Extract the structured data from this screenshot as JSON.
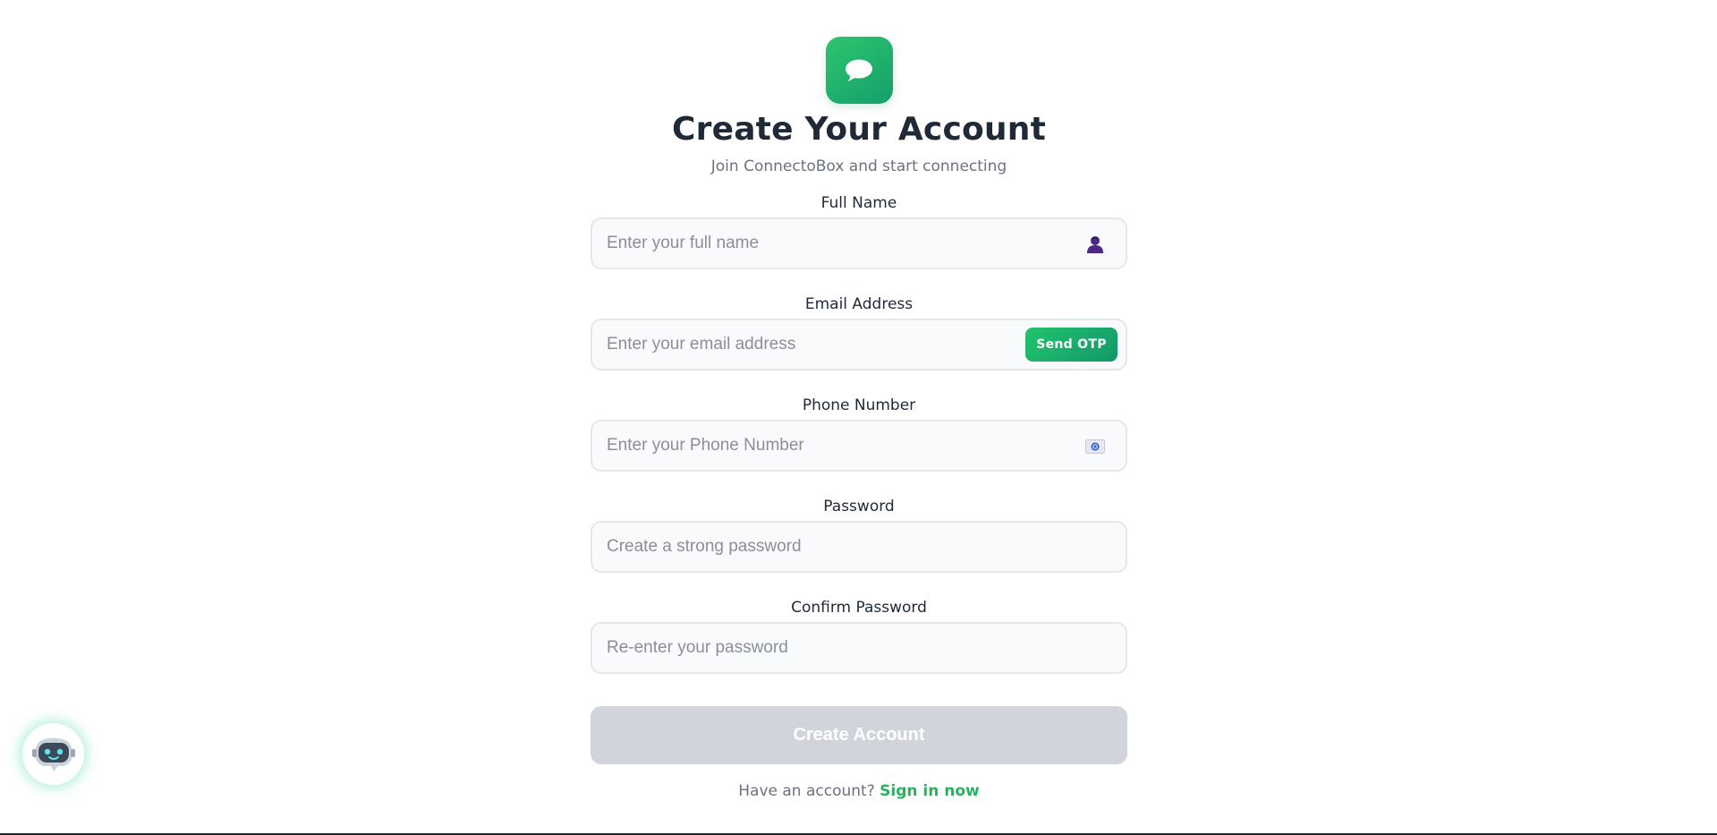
{
  "brand": {
    "logo_icon": "chat-bubble-icon",
    "accent_color": "#22c36d"
  },
  "header": {
    "title": "Create Your Account",
    "subtitle": "Join ConnectoBox and start connecting"
  },
  "form": {
    "full_name": {
      "label": "Full Name",
      "value": "",
      "placeholder": "Enter your full name",
      "icon": "person-icon"
    },
    "email": {
      "label": "Email Address",
      "value": "",
      "placeholder": "Enter your email address",
      "otp_button_label": "Send OTP"
    },
    "phone": {
      "label": "Phone Number",
      "value": "",
      "placeholder": "Enter your Phone Number",
      "icon": "phone-card-icon"
    },
    "password": {
      "label": "Password",
      "value": "",
      "placeholder": "Create a strong password"
    },
    "confirm_password": {
      "label": "Confirm Password",
      "value": "",
      "placeholder": "Re-enter your password"
    },
    "submit_label": "Create Account",
    "submit_disabled_color": "#d1d5db"
  },
  "footer": {
    "prompt": "Have an account?",
    "link_label": "Sign in now"
  },
  "assistant": {
    "icon": "robot-chat-icon"
  }
}
